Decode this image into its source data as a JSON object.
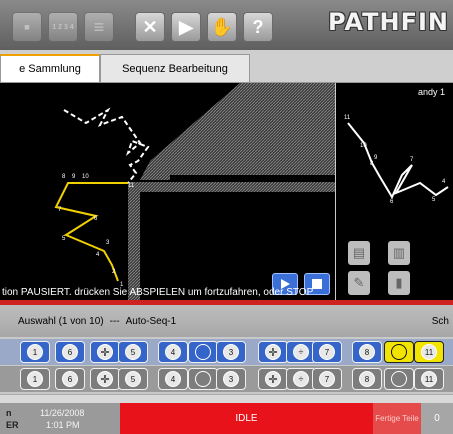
{
  "toolbar": {
    "buttons": [
      {
        "name": "save-icon",
        "glyph": "▪"
      },
      {
        "name": "numbered-list-icon",
        "glyph": "1 2 3 4"
      },
      {
        "name": "list-icon",
        "glyph": "≡"
      },
      {
        "name": "tools-icon",
        "glyph": "✕"
      },
      {
        "name": "play-icon",
        "glyph": "▶"
      },
      {
        "name": "hand-stop-icon",
        "glyph": "✋"
      },
      {
        "name": "help-icon",
        "glyph": "?"
      }
    ],
    "brand": "PATHFIN"
  },
  "tabs": [
    "e Sammlung",
    "Sequenz Bearbeitung"
  ],
  "main_view": {
    "labels": [
      "8",
      "9",
      "10",
      "11",
      "7",
      "6",
      "5",
      "4",
      "3",
      "2",
      "1"
    ],
    "status": "tion PAUSIERT. drücken Sie ABSPIELEN um fortzufahren, oder STOP"
  },
  "side_view": {
    "title": "andy 1",
    "labels": [
      "11",
      "10",
      "9",
      "8",
      "7",
      "6",
      "5",
      "4"
    ]
  },
  "selection": {
    "auswahl": "Auswahl (1 von 10)",
    "separator": "---",
    "sequence": "Auto-Seq-1",
    "right": "Sch"
  },
  "steps_row1": [
    "1",
    "6",
    "",
    "5",
    "4",
    "",
    "3",
    "",
    "7",
    "8",
    "11"
  ],
  "steps_row2": [
    "1",
    "6",
    "",
    "5",
    "4",
    "",
    "3",
    "",
    "7",
    "8",
    "11"
  ],
  "footer": {
    "left_top": "n",
    "left_bottom": "ER",
    "date": "11/26/2008",
    "time": "1:01 PM",
    "state": "IDLE",
    "done_label": "Fertige Teile",
    "count": "0"
  },
  "colors": {
    "idle_red": "#e8131a",
    "highlight_yellow": "#f2e400",
    "step_blue": "#3565c9",
    "path_yellow": "#f0d000"
  }
}
